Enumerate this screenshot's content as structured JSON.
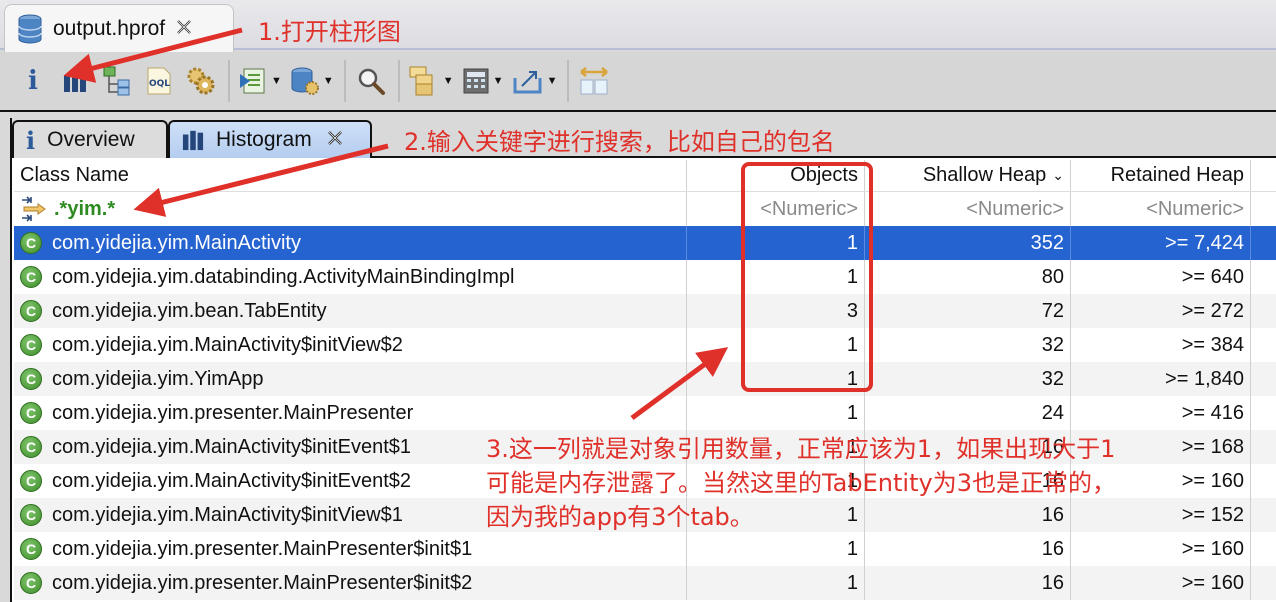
{
  "editor": {
    "tab_title": "output.hprof",
    "tab_icon": "database-icon",
    "close_glyph": "✕"
  },
  "toolbar": {
    "buttons": [
      {
        "name": "overview-button",
        "icon": "info-icon"
      },
      {
        "name": "histogram-button",
        "icon": "bar-chart-icon"
      },
      {
        "name": "dominator-tree-button",
        "icon": "tree-icon"
      },
      {
        "name": "oql-button",
        "icon": "oql-icon"
      },
      {
        "name": "heap-dump-overview-button",
        "icon": "gears-icon"
      },
      {
        "name": "run-report-button",
        "icon": "run-report-icon",
        "dropdown": true
      },
      {
        "name": "query-browser-button",
        "icon": "database-gear-icon",
        "dropdown": true
      },
      {
        "name": "find-object-button",
        "icon": "search-icon"
      },
      {
        "name": "group-result-button",
        "icon": "group-icon",
        "dropdown": true
      },
      {
        "name": "calculate-retained-button",
        "icon": "calculator-icon",
        "dropdown": true
      },
      {
        "name": "export-button",
        "icon": "export-icon",
        "dropdown": true
      },
      {
        "name": "compare-button",
        "icon": "compare-icon"
      }
    ]
  },
  "inner_tabs": [
    {
      "label": "Overview",
      "icon": "info-icon",
      "active": false
    },
    {
      "label": "Histogram",
      "icon": "bar-chart-icon",
      "active": true
    }
  ],
  "table": {
    "columns": [
      "Class Name",
      "Objects",
      "Shallow Heap",
      "Retained Heap"
    ],
    "sort_column": "Shallow Heap",
    "filter": {
      "class_name": ".*yim.*",
      "objects": "<Numeric>",
      "shallow": "<Numeric>",
      "retained": "<Numeric>"
    },
    "rows": [
      {
        "name": "com.yidejia.yim.MainActivity",
        "objects": "1",
        "shallow": "352",
        "retained": ">= 7,424",
        "selected": true
      },
      {
        "name": "com.yidejia.yim.databinding.ActivityMainBindingImpl",
        "objects": "1",
        "shallow": "80",
        "retained": ">= 640"
      },
      {
        "name": "com.yidejia.yim.bean.TabEntity",
        "objects": "3",
        "shallow": "72",
        "retained": ">= 272"
      },
      {
        "name": "com.yidejia.yim.MainActivity$initView$2",
        "objects": "1",
        "shallow": "32",
        "retained": ">= 384"
      },
      {
        "name": "com.yidejia.yim.YimApp",
        "objects": "1",
        "shallow": "32",
        "retained": ">= 1,840"
      },
      {
        "name": "com.yidejia.yim.presenter.MainPresenter",
        "objects": "1",
        "shallow": "24",
        "retained": ">= 416"
      },
      {
        "name": "com.yidejia.yim.MainActivity$initEvent$1",
        "objects": "1",
        "shallow": "16",
        "retained": ">= 168"
      },
      {
        "name": "com.yidejia.yim.MainActivity$initEvent$2",
        "objects": "1",
        "shallow": "16",
        "retained": ">= 160"
      },
      {
        "name": "com.yidejia.yim.MainActivity$initView$1",
        "objects": "1",
        "shallow": "16",
        "retained": ">= 152"
      },
      {
        "name": "com.yidejia.yim.presenter.MainPresenter$init$1",
        "objects": "1",
        "shallow": "16",
        "retained": ">= 160"
      },
      {
        "name": "com.yidejia.yim.presenter.MainPresenter$init$2",
        "objects": "1",
        "shallow": "16",
        "retained": ">= 160"
      }
    ]
  },
  "annotations": {
    "step1": "1.打开柱形图",
    "step2": "2.输入关键字进行搜索，比如自己的包名",
    "step3_line1": "3.这一列就是对象引用数量，正常应该为1，如果出现大于1",
    "step3_line2": "可能是内存泄露了。当然这里的TabEntity为3也是正常的，",
    "step3_line3": "因为我的app有3个tab。",
    "color": "#e0302a"
  }
}
